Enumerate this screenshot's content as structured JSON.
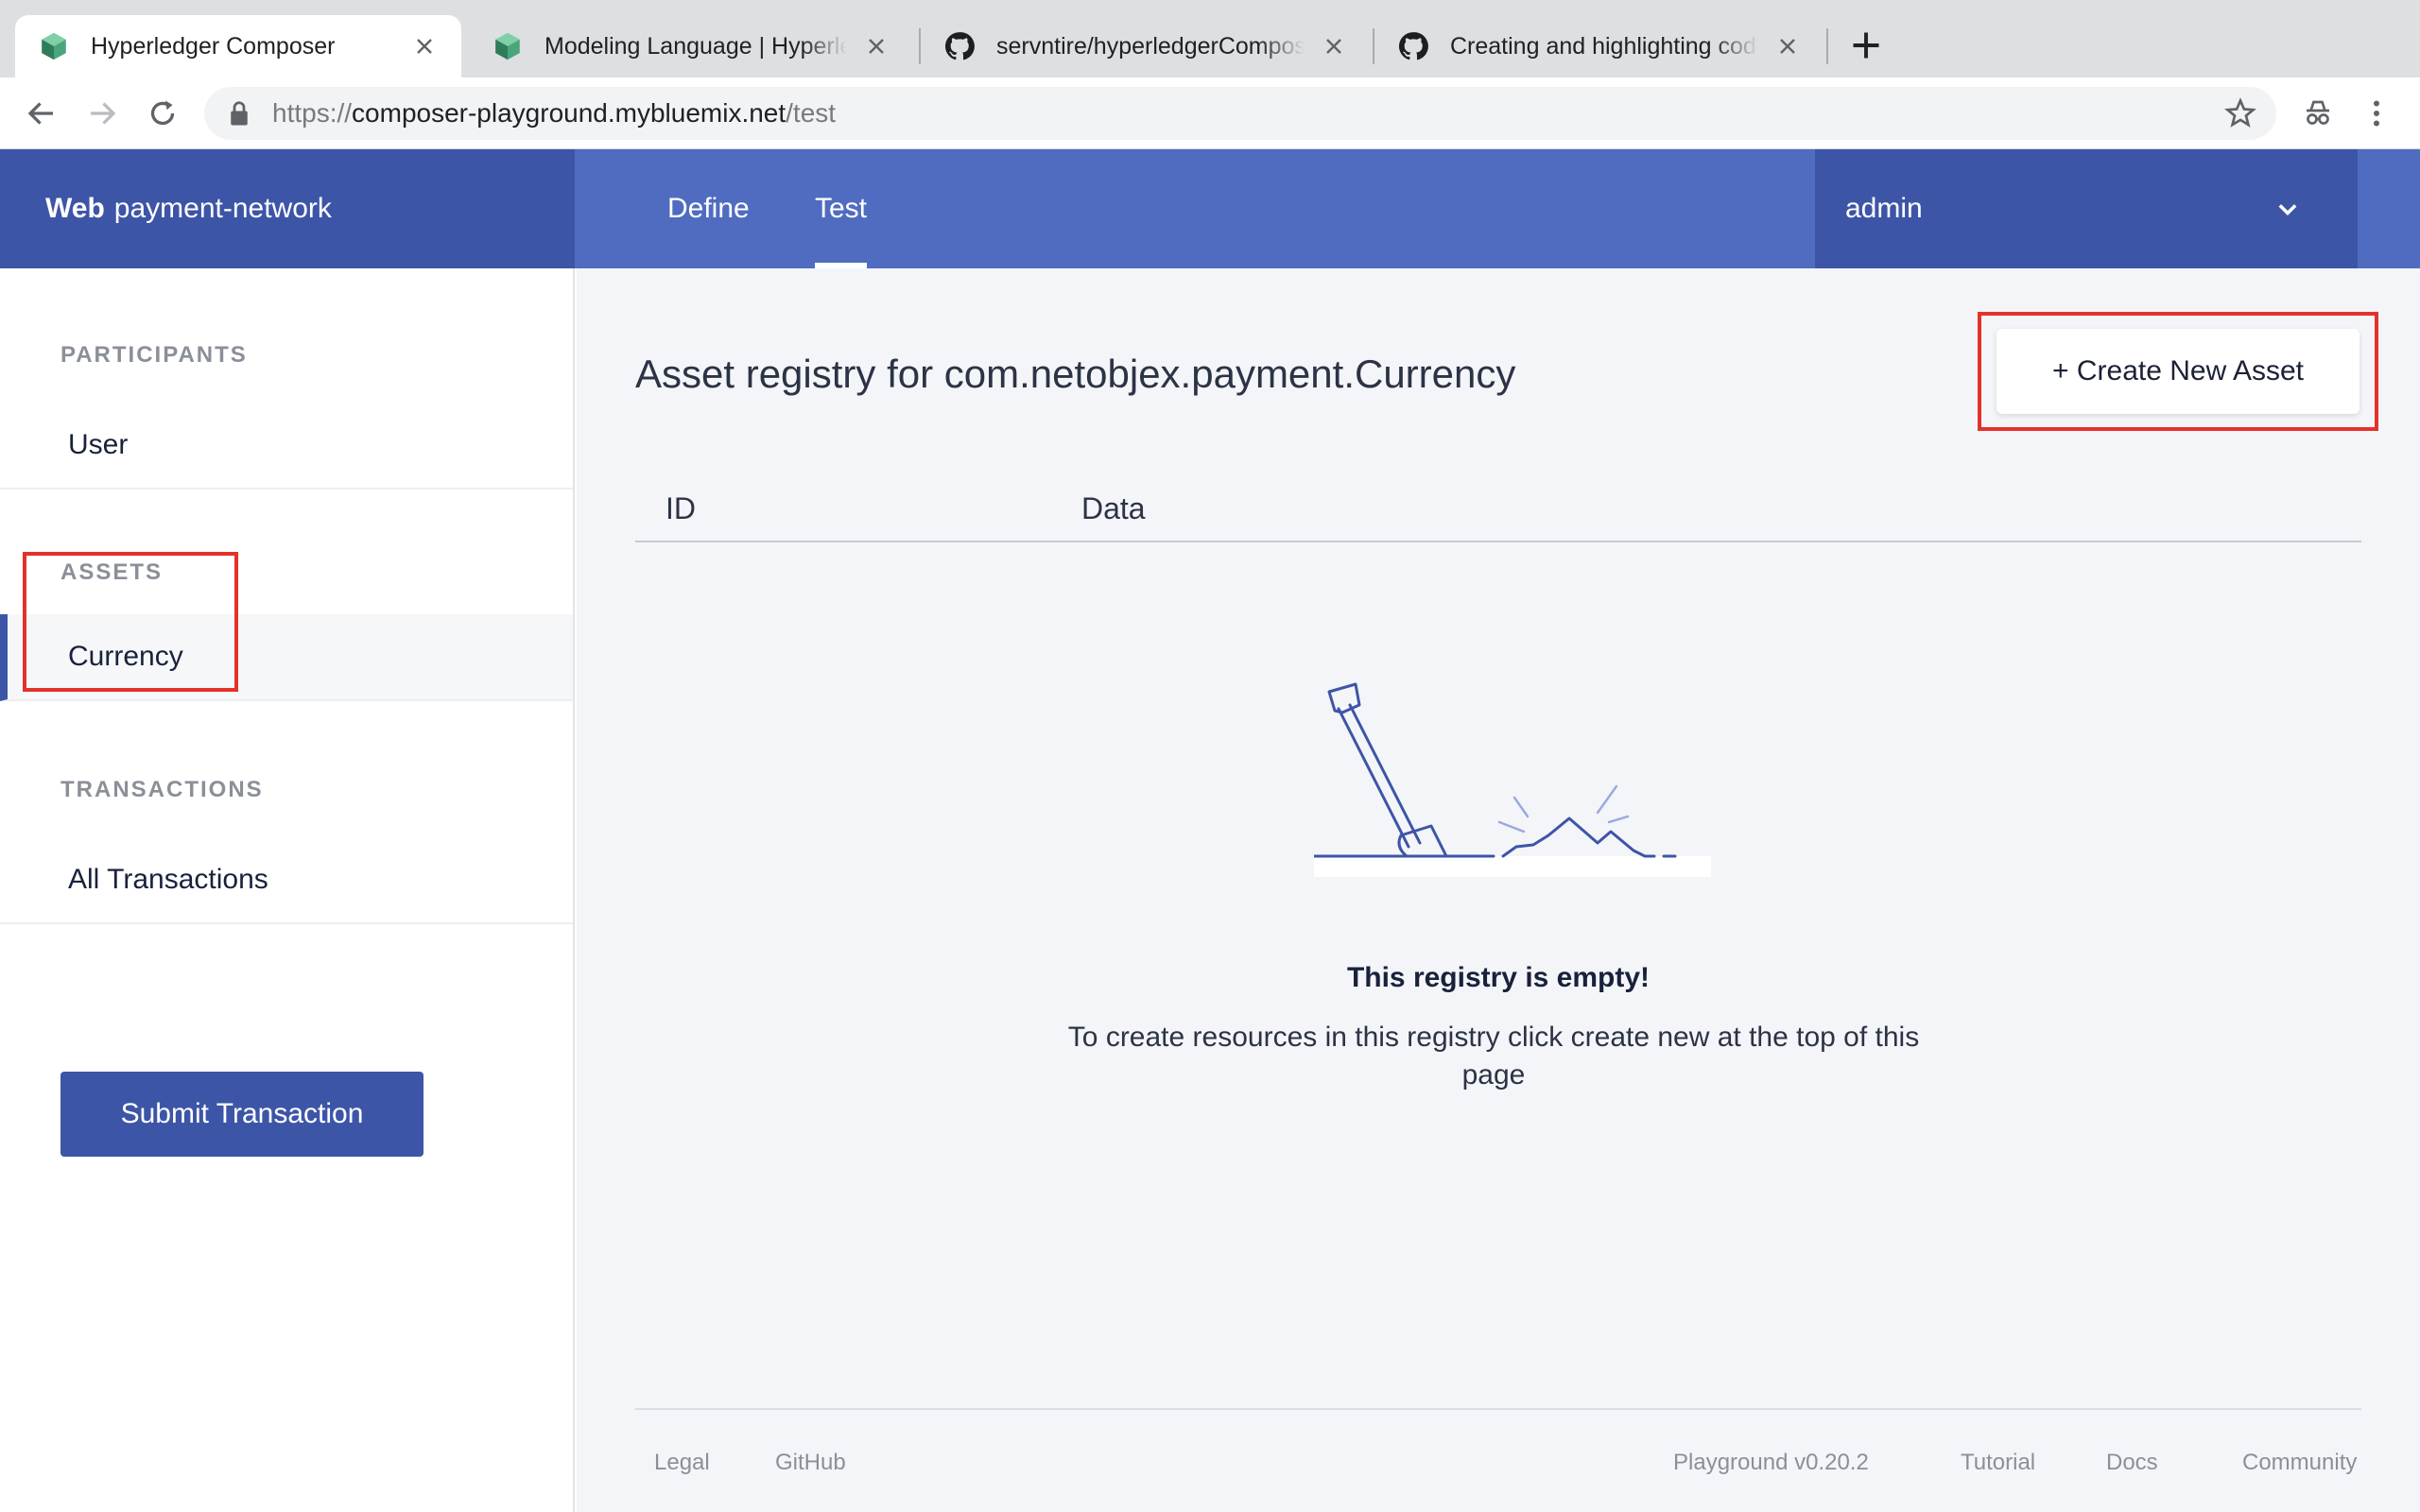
{
  "browser": {
    "tabs": [
      {
        "title": "Hyperledger Composer",
        "favicon": "composer-cube-icon",
        "active": true
      },
      {
        "title": "Modeling Language | Hyperledger Composer",
        "favicon": "composer-cube-icon",
        "active": false
      },
      {
        "title": "servntire/hyperledgerComposer",
        "favicon": "github-icon",
        "active": false
      },
      {
        "title": "Creating and highlighting code blocks",
        "favicon": "github-icon",
        "active": false
      }
    ],
    "url": {
      "scheme": "https://",
      "host": "composer-playground.mybluemix.net",
      "path": "/test"
    }
  },
  "header": {
    "brand_bold": "Web",
    "brand_name": "payment-network",
    "nav_tabs": [
      "Define",
      "Test"
    ],
    "active_tab": "Test",
    "user": "admin"
  },
  "sidebar": {
    "participants_label": "PARTICIPANTS",
    "participants": [
      "User"
    ],
    "assets_label": "ASSETS",
    "assets": [
      "Currency"
    ],
    "selected_asset": "Currency",
    "transactions_label": "TRANSACTIONS",
    "transactions": [
      "All Transactions"
    ],
    "submit_label": "Submit Transaction"
  },
  "main": {
    "title": "Asset registry for com.netobjex.payment.Currency",
    "create_button": "+ Create New Asset",
    "columns": [
      "ID",
      "Data"
    ],
    "empty_title": "This registry is empty!",
    "empty_description": "To create resources in this registry click create new at the top of this page"
  },
  "footer": {
    "left_links": [
      "Legal",
      "GitHub"
    ],
    "version": "Playground v0.20.2",
    "right_links": [
      "Tutorial",
      "Docs",
      "Community"
    ]
  },
  "colors": {
    "brand_dark": "#3d55a7",
    "brand": "#506cc0",
    "highlight_red": "#e3322b"
  }
}
